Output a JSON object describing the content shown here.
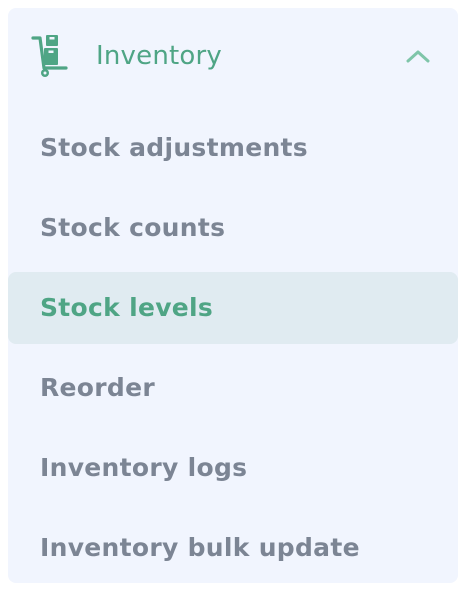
{
  "menu": {
    "title": "Inventory",
    "icon": "hand-truck-icon",
    "expanded": true,
    "accent_color": "#4fa585",
    "text_color": "#7c8594",
    "active_bg_color": "#e0ebf1",
    "panel_bg_color": "#f1f5fe",
    "items": [
      {
        "label": "Stock adjustments",
        "active": false
      },
      {
        "label": "Stock counts",
        "active": false
      },
      {
        "label": "Stock levels",
        "active": true
      },
      {
        "label": "Reorder",
        "active": false
      },
      {
        "label": "Inventory logs",
        "active": false
      },
      {
        "label": "Inventory bulk update",
        "active": false
      }
    ]
  }
}
